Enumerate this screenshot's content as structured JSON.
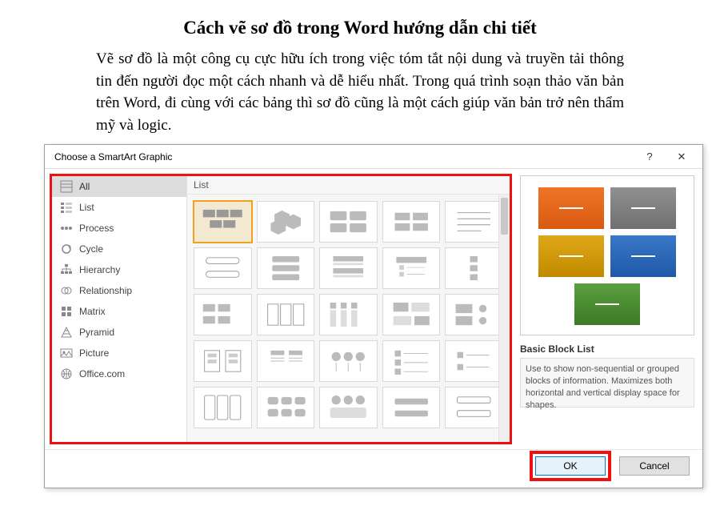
{
  "article": {
    "title": "Cách vẽ sơ đồ trong Word hướng dẫn chi tiết",
    "body": "Vẽ sơ đồ là một công cụ cực hữu ích trong việc tóm tắt nội dung và truyền tải thông tin đến người đọc một cách nhanh và dễ hiểu nhất. Trong quá trình soạn thảo văn bản trên Word, đi cùng với các bảng thì sơ đồ cũng là một cách giúp văn bản trở nên thẩm mỹ và logic."
  },
  "dialog": {
    "title": "Choose a SmartArt Graphic",
    "help": "?",
    "close": "✕",
    "categories": [
      {
        "label": "All",
        "selected": true
      },
      {
        "label": "List"
      },
      {
        "label": "Process"
      },
      {
        "label": "Cycle"
      },
      {
        "label": "Hierarchy"
      },
      {
        "label": "Relationship"
      },
      {
        "label": "Matrix"
      },
      {
        "label": "Pyramid"
      },
      {
        "label": "Picture"
      },
      {
        "label": "Office.com"
      }
    ],
    "gallery_header": "List",
    "preview": {
      "title": "Basic Block List",
      "description": "Use to show non-sequential or grouped blocks of information. Maximizes both horizontal and vertical display space for shapes.",
      "blocks": [
        "orange",
        "grey",
        "gold",
        "blue",
        "green"
      ]
    },
    "buttons": {
      "ok": "OK",
      "cancel": "Cancel"
    }
  }
}
